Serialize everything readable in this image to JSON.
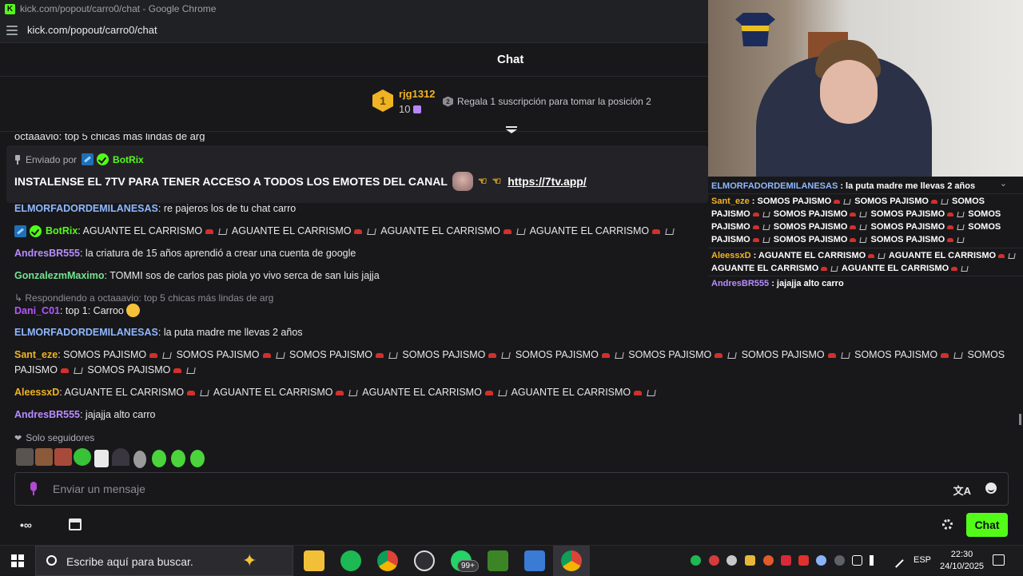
{
  "browser": {
    "title": "kick.com/popout/carro0/chat - Google Chrome",
    "url": "kick.com/popout/carro0/chat"
  },
  "chat": {
    "header": "Chat",
    "leaderboard": {
      "rank": "1",
      "user": "rjg1312",
      "count": "10",
      "next_rank": "2",
      "prompt": "Regala 1 suscripción para tomar la posición 2"
    },
    "partial_line": "octaaavio: top 5 chicas más lindas de arg",
    "pinned": {
      "sent_by": "Enviado por",
      "user": "BotRix",
      "text": "INSTALENSE EL 7TV PARA TENER ACCESO A TODOS LOS EMOTES DEL CANAL",
      "link": "https://7tv.app/"
    },
    "messages": [
      {
        "user": "ELMORFADORDEMILANESAS",
        "color": "#8fb8ff",
        "text": ": re pajeros los de tu chat carro"
      },
      {
        "user": "BotRix",
        "color": "#53fc18",
        "text": ": AGUANTE EL CARRISMO",
        "segs": [
          "AGUANTE EL CARRISMO",
          "AGUANTE EL CARRISMO",
          "AGUANTE EL CARRISMO"
        ]
      },
      {
        "user": "AndresBR555",
        "color": "#b98cff",
        "text": ": la criatura de 15 años aprendió a crear una cuenta de google"
      },
      {
        "user": "GonzalezmMaximo",
        "color": "#74e38f",
        "text": ": TOMMI sos de carlos pas piola yo vivo serca de san luis jajja"
      },
      {
        "reply": "Respondiendo a octaaavio: top 5 chicas más lindas de arg"
      },
      {
        "user": "Dani_C01",
        "color": "#b556ff",
        "text": ": top 1: Carroo"
      },
      {
        "user": "ELMORFADORDEMILANESAS",
        "color": "#8fb8ff",
        "text": ": la puta madre me llevas 2 años"
      },
      {
        "user": "Sant_eze",
        "color": "#f0b323",
        "text": ": SOMOS PAJISMO",
        "segs": [
          "SOMOS PAJISMO",
          "SOMOS PAJISMO",
          "SOMOS PAJISMO",
          "SOMOS PAJISMO",
          "SOMOS PAJISMO",
          "SOMOS PAJISMO",
          "SOMOS PAJISMO",
          "SOMOS"
        ],
        "line2_start": "PAJISMO",
        "line2_seg": "SOMOS PAJISMO"
      },
      {
        "user": "AleessxD",
        "color": "#f0b323",
        "text": ": AGUANTE EL CARRISMO",
        "segs": [
          "AGUANTE EL CARRISMO",
          "AGUANTE EL CARRISMO",
          "AGUANTE EL CARRISMO"
        ]
      },
      {
        "user": "AndresBR555",
        "color": "#b98cff",
        "text": ": jajajja alto carro"
      }
    ],
    "followers_only": "Solo seguidores",
    "input_placeholder": "Enviar un mensaje",
    "send_button": "Chat"
  },
  "overlay": {
    "messages": [
      {
        "user": "ELMORFADORDEMILANESAS",
        "color": "#8fb8ff",
        "text": " : la puta madre me llevas 2 años"
      },
      {
        "user": "Sant_eze",
        "color": "#f0b323",
        "text": " : SOMOS PAJISMO",
        "segs": [
          "SOMOS PAJISMO",
          "SOMOS PAJISMO",
          "SOMOS PAJISMO",
          "SOMOS PAJISMO",
          "SOMOS PAJISMO",
          "SOMOS PAJISMO",
          "SOMOS PAJISMO",
          "SOMOS PAJISMO",
          "SOMOS PAJISMO",
          "SOMOS PAJISMO"
        ]
      },
      {
        "user": "AleessxD",
        "color": "#f0b323",
        "text": " : AGUANTE EL CARRISMO",
        "segs": [
          "AGUANTE EL CARRISMO",
          "AGUANTE EL CARRISMO",
          "AGUANTE EL CARRISMO"
        ]
      },
      {
        "user": "AndresBR555",
        "color": "#b98cff",
        "text": " : jajajja alto carro"
      }
    ]
  },
  "taskbar": {
    "search_placeholder": "Escribe aquí para buscar.",
    "notification_count": "99+",
    "language": "ESP",
    "time": "22:30",
    "date": "24/10/2025"
  },
  "icons": [
    "kick-logo-icon",
    "tune-icon",
    "medal-icon",
    "gift-icon",
    "gift-sub-icon",
    "expand-icon",
    "pin-icon",
    "botrix-badge-icon",
    "verified-icon",
    "heart-icon",
    "mic-icon",
    "translate-icon",
    "emoji-icon",
    "infinity-icon",
    "store-icon",
    "gear-icon",
    "windows-icon",
    "search-icon"
  ]
}
